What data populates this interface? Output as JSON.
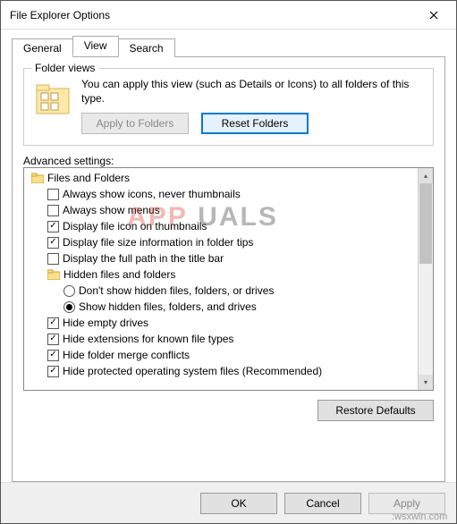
{
  "window": {
    "title": "File Explorer Options"
  },
  "tabs": {
    "general": "General",
    "view": "View",
    "search": "Search"
  },
  "folderviews": {
    "title": "Folder views",
    "description": "You can apply this view (such as Details or Icons) to all folders of this type.",
    "apply_btn": "Apply to Folders",
    "reset_btn": "Reset Folders"
  },
  "advanced": {
    "label": "Advanced settings:",
    "root": "Files and Folders",
    "items": [
      {
        "type": "check",
        "checked": false,
        "label": "Always show icons, never thumbnails"
      },
      {
        "type": "check",
        "checked": false,
        "label": "Always show menus"
      },
      {
        "type": "check",
        "checked": true,
        "label": "Display file icon on thumbnails"
      },
      {
        "type": "check",
        "checked": true,
        "label": "Display file size information in folder tips"
      },
      {
        "type": "check",
        "checked": false,
        "label": "Display the full path in the title bar"
      },
      {
        "type": "folder",
        "label": "Hidden files and folders"
      },
      {
        "type": "radio",
        "checked": false,
        "label": "Don't show hidden files, folders, or drives"
      },
      {
        "type": "radio",
        "checked": true,
        "label": "Show hidden files, folders, and drives"
      },
      {
        "type": "check",
        "checked": true,
        "label": "Hide empty drives"
      },
      {
        "type": "check",
        "checked": true,
        "label": "Hide extensions for known file types"
      },
      {
        "type": "check",
        "checked": true,
        "label": "Hide folder merge conflicts"
      },
      {
        "type": "check",
        "checked": true,
        "label": "Hide protected operating system files (Recommended)"
      }
    ]
  },
  "restore_btn": "Restore Defaults",
  "footer": {
    "ok": "OK",
    "cancel": "Cancel",
    "apply": "Apply"
  },
  "watermark": {
    "a": "APP",
    "b": "UALS"
  },
  "source_url": ":wsxwin.com"
}
